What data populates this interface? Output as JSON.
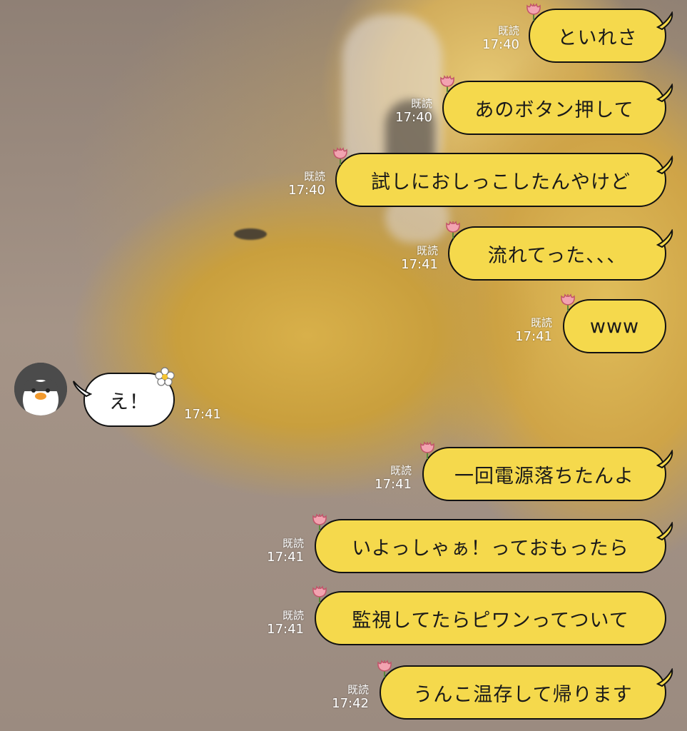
{
  "colors": {
    "outgoing_bubble": "#f5d94c",
    "incoming_bubble": "#ffffff",
    "outline": "#111111"
  },
  "icons": {
    "read_mark": "tulip-icon",
    "incoming_mark": "flower-icon",
    "avatar": "penguin-avatar"
  },
  "messages": [
    {
      "side": "right",
      "read": "既読",
      "time": "17:40",
      "text": "といれさ"
    },
    {
      "side": "right",
      "read": "既読",
      "time": "17:40",
      "text": "あのボタン押して"
    },
    {
      "side": "right",
      "read": "既読",
      "time": "17:40",
      "text": "試しにおしっこしたんやけど"
    },
    {
      "side": "right",
      "read": "既読",
      "time": "17:41",
      "text": "流れてった、、、"
    },
    {
      "side": "right",
      "read": "既読",
      "time": "17:41",
      "text": "www"
    },
    {
      "side": "left",
      "time": "17:41",
      "text": "え！"
    },
    {
      "side": "right",
      "read": "既読",
      "time": "17:41",
      "text": "一回電源落ちたんよ"
    },
    {
      "side": "right",
      "read": "既読",
      "time": "17:41",
      "text": "いよっしゃぁ！っておもったら"
    },
    {
      "side": "right",
      "read": "既読",
      "time": "17:41",
      "text": "監視してたらピワンってついて"
    },
    {
      "side": "right",
      "read": "既読",
      "time": "17:42",
      "text": "うんこ温存して帰ります"
    }
  ]
}
